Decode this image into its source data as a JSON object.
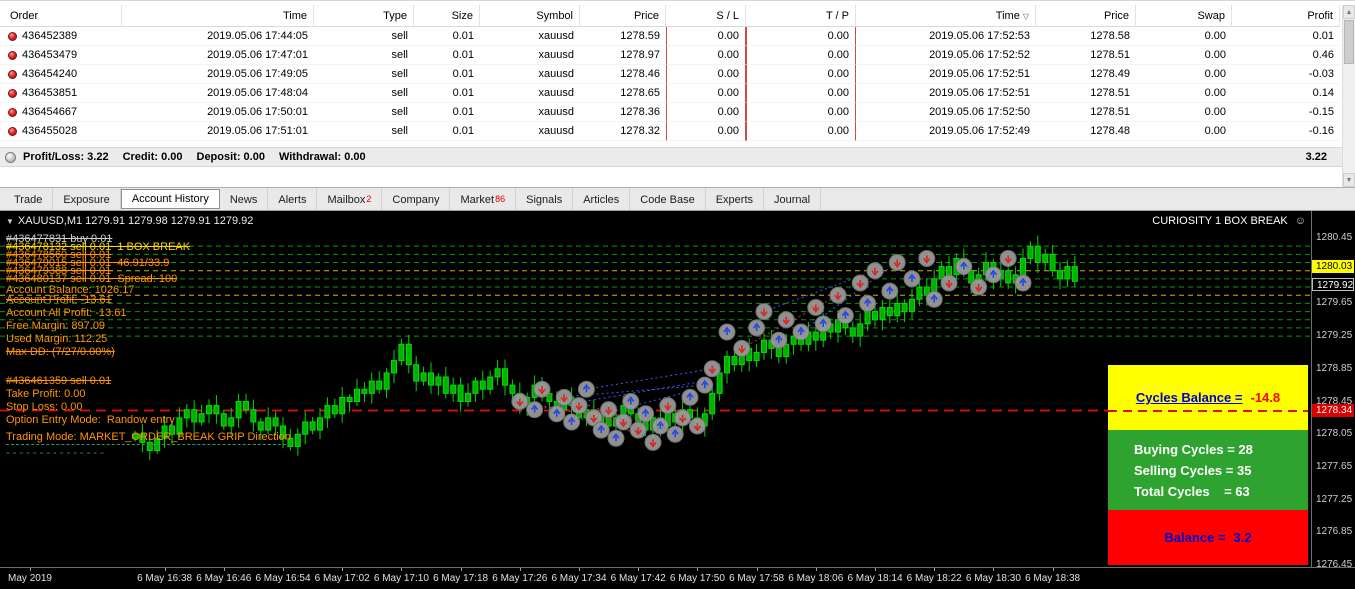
{
  "icons": {
    "sort_desc": "▽",
    "dropdown": "▼",
    "smiley": "☺",
    "scroll_up": "▲",
    "scroll_down": "▼",
    "info": " "
  },
  "terminal": {
    "columns": [
      "Order",
      "Time",
      "Type",
      "Size",
      "Symbol",
      "Price",
      "S / L",
      "T / P",
      "Time",
      "Price",
      "Swap",
      "Profit"
    ],
    "sort_column_index": 8,
    "rows": [
      {
        "order": "436452389",
        "open_time": "2019.05.06 17:44:05",
        "type": "sell",
        "size": "0.01",
        "symbol": "xauusd",
        "open_price": "1278.59",
        "sl": "0.00",
        "tp": "0.00",
        "close_time": "2019.05.06 17:52:53",
        "close_price": "1278.58",
        "swap": "0.00",
        "profit": "0.01"
      },
      {
        "order": "436453479",
        "open_time": "2019.05.06 17:47:01",
        "type": "sell",
        "size": "0.01",
        "symbol": "xauusd",
        "open_price": "1278.97",
        "sl": "0.00",
        "tp": "0.00",
        "close_time": "2019.05.06 17:52:52",
        "close_price": "1278.51",
        "swap": "0.00",
        "profit": "0.46"
      },
      {
        "order": "436454240",
        "open_time": "2019.05.06 17:49:05",
        "type": "sell",
        "size": "0.01",
        "symbol": "xauusd",
        "open_price": "1278.46",
        "sl": "0.00",
        "tp": "0.00",
        "close_time": "2019.05.06 17:52:51",
        "close_price": "1278.49",
        "swap": "0.00",
        "profit": "-0.03"
      },
      {
        "order": "436453851",
        "open_time": "2019.05.06 17:48:04",
        "type": "sell",
        "size": "0.01",
        "symbol": "xauusd",
        "open_price": "1278.65",
        "sl": "0.00",
        "tp": "0.00",
        "close_time": "2019.05.06 17:52:51",
        "close_price": "1278.51",
        "swap": "0.00",
        "profit": "0.14"
      },
      {
        "order": "436454667",
        "open_time": "2019.05.06 17:50:01",
        "type": "sell",
        "size": "0.01",
        "symbol": "xauusd",
        "open_price": "1278.36",
        "sl": "0.00",
        "tp": "0.00",
        "close_time": "2019.05.06 17:52:50",
        "close_price": "1278.51",
        "swap": "0.00",
        "profit": "-0.15"
      },
      {
        "order": "436455028",
        "open_time": "2019.05.06 17:51:01",
        "type": "sell",
        "size": "0.01",
        "symbol": "xauusd",
        "open_price": "1278.32",
        "sl": "0.00",
        "tp": "0.00",
        "close_time": "2019.05.06 17:52:49",
        "close_price": "1278.48",
        "swap": "0.00",
        "profit": "-0.16"
      }
    ],
    "summary_items": [
      {
        "label": "Profit/Loss:",
        "value": "3.22"
      },
      {
        "label": "Credit:",
        "value": "0.00"
      },
      {
        "label": "Deposit:",
        "value": "0.00"
      },
      {
        "label": "Withdrawal:",
        "value": "0.00"
      }
    ],
    "summary": {
      "total": "3.22"
    }
  },
  "tabs": [
    {
      "label": "Trade"
    },
    {
      "label": "Exposure"
    },
    {
      "label": "Account History",
      "selected": true
    },
    {
      "label": "News"
    },
    {
      "label": "Alerts"
    },
    {
      "label": "Mailbox",
      "badge": "2"
    },
    {
      "label": "Company"
    },
    {
      "label": "Market",
      "badge": "86"
    },
    {
      "label": "Signals"
    },
    {
      "label": "Articles"
    },
    {
      "label": "Code Base"
    },
    {
      "label": "Experts"
    },
    {
      "label": "Journal"
    }
  ],
  "chart": {
    "title_symbol": "XAUUSD,M1",
    "title_ohlc": "1279.91 1279.98 1279.91 1279.92",
    "corner_label": "CURIOSITY 1 BOX BREAK",
    "overlay_lines": [
      {
        "text": "#436477831 buy 0.01",
        "color": "#d0d0d0",
        "strike": true,
        "mt": 0
      },
      {
        "text": "#436478132 sell 0.01  1 BOX BREAK",
        "color": "#ffd700",
        "strike": true,
        "mt": -5
      },
      {
        "text": "#436478560 sell 0.01",
        "color": "#ff9500",
        "strike": true,
        "mt": -5
      },
      {
        "text": "#436479015 sell 0.01  46.91/33.9",
        "color": "#ff9500",
        "strike": true,
        "mt": -5
      },
      {
        "text": "#436479388 sell 0.01",
        "color": "#ff9500",
        "strike": true,
        "mt": -5
      },
      {
        "text": "#436480137 sell 0.01  Spread: 100",
        "color": "#ff9500",
        "strike": true,
        "mt": -5
      },
      {
        "text": "Account Balance: 1026.17",
        "color": "#ff9500",
        "mt": -2
      },
      {
        "text": "Account Profit: -13.61",
        "color": "#ff9500",
        "strike": true,
        "mt": -3
      },
      {
        "text": "Account All Profit: -13.61",
        "color": "#ff9500",
        "mt": 0
      },
      {
        "text": "Free Margin: 897.09",
        "color": "#ff9500",
        "mt": 0
      },
      {
        "text": "Used Margin: 112.25",
        "color": "#ff9500",
        "mt": 0
      },
      {
        "text": "Max DD: (7/27/0.00%)",
        "color": "#ff9500",
        "strike": true,
        "mt": 0
      },
      {
        "text": "#436461359 sell 0.01",
        "color": "#ff9500",
        "strike": true,
        "mt": 16
      },
      {
        "text": "Take Profit: 0.00",
        "color": "#ff9500",
        "mt": 0
      },
      {
        "text": "Stop Loss: 0.00",
        "color": "#ff9500",
        "mt": 0
      },
      {
        "text": "Option Entry Mode:  Randow entry",
        "color": "#ff9500",
        "mt": 0
      },
      {
        "text": "Trading Mode: MARKET_ORDER_BREAK GRIP Direction",
        "color": "#ff9500",
        "dashu": true,
        "mt": 0
      },
      {
        "text": "- - - - - - - - - - - - - - -",
        "color": "#2f9e4f",
        "mt": 2
      }
    ],
    "info_boxes": {
      "cycles_label": "Cycles Balance =",
      "cycles_value": "-14.8",
      "counts": [
        "Buying Cycles = 28",
        "Selling Cycles = 35",
        "Total Cycles    = 63"
      ],
      "balance_label": "Balance =",
      "balance_value": "3.2"
    },
    "price_scale": {
      "labels": [
        "1280.45",
        "1279.65",
        "1279.25",
        "1278.85",
        "1278.45",
        "1278.05",
        "1277.65",
        "1277.25",
        "1276.85",
        "1276.45"
      ],
      "ask_tag": "1280.03",
      "bid_tag": "1279.92",
      "stop_tag": "1278.34"
    },
    "time_axis": [
      "May 2019",
      "6 May 16:38",
      "6 May 16:46",
      "6 May 16:54",
      "6 May 17:02",
      "6 May 17:10",
      "6 May 17:18",
      "6 May 17:26",
      "6 May 17:34",
      "6 May 17:42",
      "6 May 17:50",
      "6 May 17:58",
      "6 May 18:06",
      "6 May 18:14",
      "6 May 18:22",
      "6 May 18:30",
      "6 May 18:38"
    ]
  },
  "chart_data": {
    "type": "candlestick",
    "symbol": "XAUUSD",
    "timeframe": "M1",
    "ylim": [
      1276.45,
      1280.45
    ],
    "grid_step": 0.4,
    "x_start": "6 May 16:34",
    "closes": [
      1278.05,
      1277.95,
      1277.85,
      1278.0,
      1278.15,
      1278.05,
      1278.25,
      1278.35,
      1278.2,
      1278.3,
      1278.4,
      1278.3,
      1278.15,
      1278.25,
      1278.45,
      1278.35,
      1278.2,
      1278.1,
      1278.25,
      1278.15,
      1278.0,
      1277.9,
      1278.05,
      1278.2,
      1278.1,
      1278.25,
      1278.4,
      1278.3,
      1278.5,
      1278.45,
      1278.6,
      1278.55,
      1278.7,
      1278.6,
      1278.8,
      1278.95,
      1279.15,
      1278.9,
      1278.7,
      1278.8,
      1278.65,
      1278.75,
      1278.55,
      1278.65,
      1278.45,
      1278.55,
      1278.7,
      1278.6,
      1278.75,
      1278.85,
      1278.65,
      1278.55,
      1278.4,
      1278.5,
      1278.65,
      1278.55,
      1278.45,
      1278.35,
      1278.5,
      1278.4,
      1278.25,
      1278.35,
      1278.2,
      1278.3,
      1278.15,
      1278.25,
      1278.4,
      1278.3,
      1278.2,
      1278.1,
      1278.25,
      1278.15,
      1278.3,
      1278.2,
      1278.35,
      1278.25,
      1278.15,
      1278.3,
      1278.55,
      1278.8,
      1279.0,
      1278.9,
      1279.1,
      1278.95,
      1279.05,
      1279.2,
      1279.1,
      1279.0,
      1279.15,
      1279.25,
      1279.15,
      1279.3,
      1279.2,
      1279.4,
      1279.3,
      1279.45,
      1279.35,
      1279.25,
      1279.4,
      1279.55,
      1279.45,
      1279.6,
      1279.5,
      1279.65,
      1279.55,
      1279.7,
      1279.85,
      1279.75,
      1279.95,
      1280.1,
      1280.0,
      1280.2,
      1280.05,
      1279.9,
      1280.0,
      1280.15,
      1279.95,
      1280.05,
      1279.9,
      1280.0,
      1280.2,
      1280.35,
      1280.15,
      1280.25,
      1280.05,
      1279.95,
      1280.1,
      1279.92
    ],
    "box_levels_green": [
      1280.35,
      1280.25,
      1280.15,
      1279.95,
      1279.85,
      1279.65,
      1279.55,
      1279.45,
      1279.35,
      1279.25
    ],
    "box_levels_yellow": [
      1280.05,
      1279.75
    ],
    "stop_line": 1278.34,
    "markers": [
      [
        52,
        1278.45,
        "s"
      ],
      [
        54,
        1278.35,
        "b"
      ],
      [
        55,
        1278.6,
        "s"
      ],
      [
        57,
        1278.3,
        "b"
      ],
      [
        58,
        1278.5,
        "s"
      ],
      [
        59,
        1278.2,
        "b"
      ],
      [
        60,
        1278.4,
        "s"
      ],
      [
        61,
        1278.6,
        "b"
      ],
      [
        62,
        1278.25,
        "s"
      ],
      [
        63,
        1278.1,
        "b"
      ],
      [
        64,
        1278.35,
        "s"
      ],
      [
        65,
        1278.0,
        "b"
      ],
      [
        66,
        1278.2,
        "s"
      ],
      [
        67,
        1278.45,
        "b"
      ],
      [
        68,
        1278.1,
        "s"
      ],
      [
        69,
        1278.3,
        "b"
      ],
      [
        70,
        1277.95,
        "s"
      ],
      [
        71,
        1278.15,
        "b"
      ],
      [
        72,
        1278.4,
        "s"
      ],
      [
        73,
        1278.05,
        "b"
      ],
      [
        74,
        1278.25,
        "s"
      ],
      [
        75,
        1278.5,
        "b"
      ],
      [
        76,
        1278.15,
        "s"
      ],
      [
        77,
        1278.65,
        "b"
      ],
      [
        78,
        1278.85,
        "s"
      ],
      [
        80,
        1279.3,
        "b"
      ],
      [
        82,
        1279.1,
        "s"
      ],
      [
        84,
        1279.35,
        "b"
      ],
      [
        85,
        1279.55,
        "s"
      ],
      [
        87,
        1279.2,
        "b"
      ],
      [
        88,
        1279.45,
        "s"
      ],
      [
        90,
        1279.3,
        "b"
      ],
      [
        92,
        1279.6,
        "s"
      ],
      [
        93,
        1279.4,
        "b"
      ],
      [
        95,
        1279.75,
        "s"
      ],
      [
        96,
        1279.5,
        "b"
      ],
      [
        98,
        1279.9,
        "s"
      ],
      [
        99,
        1279.65,
        "b"
      ],
      [
        100,
        1280.05,
        "s"
      ],
      [
        102,
        1279.8,
        "b"
      ],
      [
        103,
        1280.15,
        "s"
      ],
      [
        105,
        1279.95,
        "b"
      ],
      [
        107,
        1280.2,
        "s"
      ],
      [
        108,
        1279.7,
        "b"
      ],
      [
        110,
        1279.9,
        "s"
      ],
      [
        112,
        1280.1,
        "b"
      ],
      [
        114,
        1279.85,
        "s"
      ],
      [
        116,
        1280.0,
        "b"
      ],
      [
        118,
        1280.2,
        "s"
      ],
      [
        120,
        1279.9,
        "b"
      ]
    ],
    "connectors": [
      [
        57,
        1278.5,
        77,
        1278.65,
        "blue"
      ],
      [
        54,
        1278.35,
        77,
        1278.7,
        "blue"
      ],
      [
        59,
        1278.2,
        76,
        1278.6,
        "blue"
      ],
      [
        61,
        1278.6,
        78,
        1278.85,
        "blue"
      ],
      [
        52,
        1278.45,
        66,
        1278.2,
        "red"
      ],
      [
        55,
        1278.6,
        70,
        1277.95,
        "red"
      ],
      [
        58,
        1278.5,
        73,
        1278.05,
        "red"
      ],
      [
        85,
        1279.55,
        100,
        1280.05,
        "blue"
      ],
      [
        82,
        1279.1,
        95,
        1279.75,
        "red"
      ],
      [
        90,
        1279.3,
        103,
        1280.15,
        "blue"
      ]
    ],
    "cycles_balance": -14.8,
    "buying_cycles": 28,
    "selling_cycles": 35,
    "total_cycles": 63,
    "balance": 3.2
  }
}
